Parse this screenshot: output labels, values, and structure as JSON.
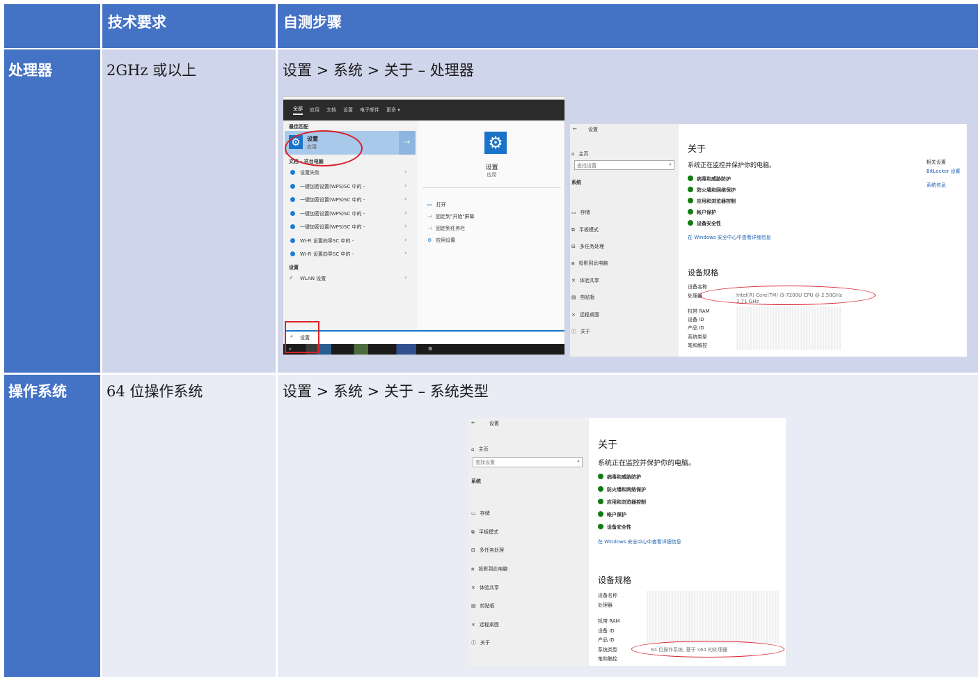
{
  "table": {
    "header": {
      "col1": "",
      "col2": "技术要求",
      "col3": "自测步骤"
    },
    "rows": [
      {
        "label": "处理器",
        "requirement": "2GHz 或以上",
        "steps": "设置 > 系统 > 关于 – 处理器"
      },
      {
        "label": "操作系统",
        "requirement": "64 位操作系统",
        "steps": "设置 > 系统 > 关于 – 系统类型"
      }
    ]
  },
  "search_shot": {
    "tabs": [
      "全部",
      "应用",
      "文档",
      "设置",
      "电子邮件",
      "更多 ▾"
    ],
    "best_match_heading": "最佳匹配",
    "best_match_title": "设置",
    "best_match_sub": "应用",
    "docs_heading": "文档 - 这台电脑",
    "results": [
      "设置失败",
      "一键加密设置(WPS)SC 中的 -",
      "一键加密设置(WPS)SC 中的 -",
      "一键加密设置(WPS)SC 中的 -",
      "一键加密设置(WPS)SC 中的 -",
      "Wi-Fi 设置向导SC 中的 -",
      "Wi-Fi 设置向导SC 中的 -"
    ],
    "settings_heading": "设置",
    "wlan": "WLAN 设置",
    "right_title": "设置",
    "right_sub": "应用",
    "actions": [
      "打开",
      "固定到\"开始\"屏幕",
      "固定到任务栏",
      "应用设置"
    ],
    "search_value": "设置"
  },
  "about_shot": {
    "back": "←",
    "window_title": "设置",
    "home": "主页",
    "search_placeholder": "查找设置",
    "system": "系统",
    "nav": [
      "存储",
      "平板模式",
      "多任务处理",
      "投影到此电脑",
      "体验共享",
      "剪贴板",
      "远程桌面",
      "关于"
    ],
    "about_title": "关于",
    "protect_text": "系统正在监控并保护你的电脑。",
    "checks": [
      "病毒和威胁防护",
      "防火墙和网络保护",
      "应用和浏览器控制",
      "帐户保护",
      "设备安全性"
    ],
    "security_link": "在 Windows 安全中心中查看详细信息",
    "related_heading": "相关设置",
    "bitlocker": "BitLocker 设置",
    "sysinfo": "系统信息",
    "spec_title": "设备规格",
    "spec_labels": [
      "设备名称",
      "处理器",
      "机带 RAM",
      "设备 ID",
      "产品 ID",
      "系统类型",
      "笔和触控"
    ],
    "processor_value": "Intel(R) Core(TM) i5-7200U CPU @ 2.50GHz   2.71 GHz",
    "systype_value": "64 位操作系统, 基于 x64 的处理器"
  },
  "colors": {
    "header": "#4472c4",
    "row1": "#cfd5ea",
    "row2": "#e9ebf5",
    "annot": "#d9202a"
  }
}
